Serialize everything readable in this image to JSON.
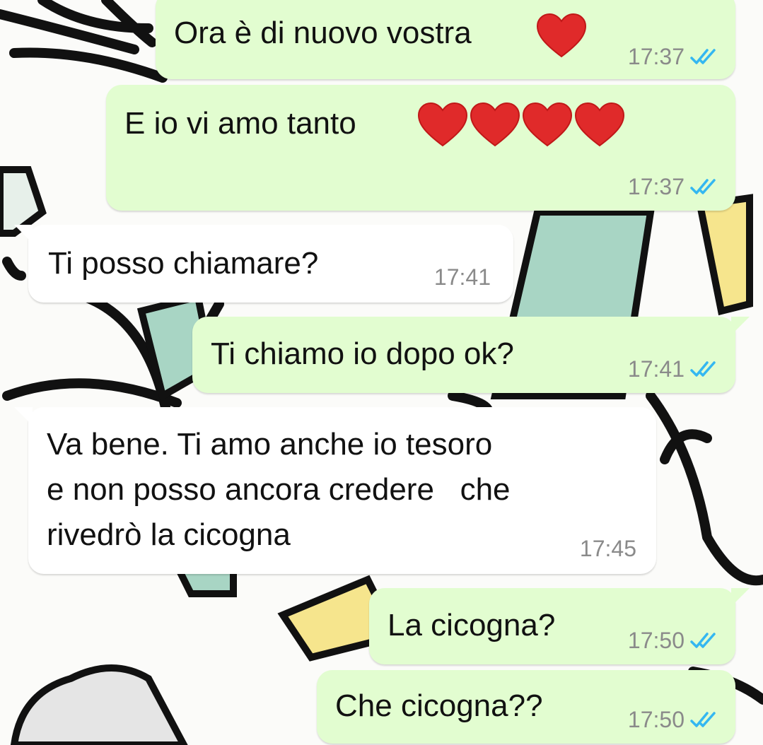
{
  "colors": {
    "outgoing_bubble": "#e2fdd0",
    "incoming_bubble": "#ffffff",
    "read_ticks": "#34b7f1",
    "heart": "#e02a2a",
    "timestamp": "#8a8a8a"
  },
  "messages": [
    {
      "direction": "outgoing",
      "text": "Ora è di nuovo vostra",
      "emoji": [
        "heart-emoji"
      ],
      "time": "17:37",
      "status_icon": "double-check-read-icon"
    },
    {
      "direction": "outgoing",
      "text": "E io vi amo tanto",
      "emoji": [
        "heart-emoji",
        "heart-emoji",
        "heart-emoji",
        "heart-emoji"
      ],
      "time": "17:37",
      "status_icon": "double-check-read-icon"
    },
    {
      "direction": "incoming",
      "text": "Ti posso chiamare?",
      "time": "17:41"
    },
    {
      "direction": "outgoing",
      "text": "Ti chiamo io dopo ok?",
      "time": "17:41",
      "status_icon": "double-check-read-icon"
    },
    {
      "direction": "incoming",
      "lines": [
        "Va bene. Ti amo anche io tesoro",
        "e non posso ancora credere   che",
        "rivedrò la cicogna"
      ],
      "time": "17:45"
    },
    {
      "direction": "outgoing",
      "text": "La cicogna?",
      "time": "17:50",
      "status_icon": "double-check-read-icon"
    },
    {
      "direction": "outgoing",
      "text": "Che cicogna??",
      "time": "17:50",
      "status_icon": "double-check-read-icon"
    }
  ]
}
